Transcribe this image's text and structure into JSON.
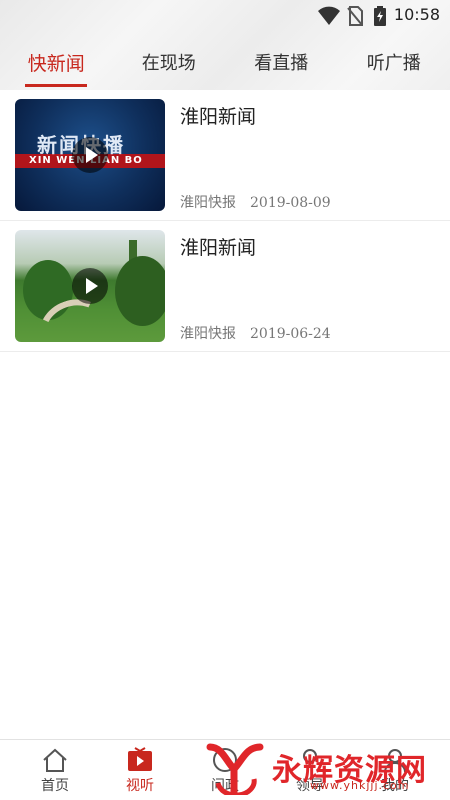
{
  "status_bar": {
    "time": "10:58"
  },
  "tabs": [
    {
      "label": "快新闻"
    },
    {
      "label": "在现场"
    },
    {
      "label": "看直播"
    },
    {
      "label": "听广播"
    }
  ],
  "news": [
    {
      "title": "淮阳新闻",
      "source": "淮阳快报",
      "date": "2019-08-09",
      "thumb_text_cn": "新闻快播",
      "thumb_text_en": "XIN WEN LIAN BO"
    },
    {
      "title": "淮阳新闻",
      "source": "淮阳快报",
      "date": "2019-06-24"
    }
  ],
  "bottom_nav": [
    {
      "label": "首页",
      "icon": "home-icon"
    },
    {
      "label": "视听",
      "icon": "video-tv-icon"
    },
    {
      "label": "问政",
      "icon": "question-icon"
    },
    {
      "label": "领导",
      "icon": "leader-icon"
    },
    {
      "label": "我的",
      "icon": "user-icon"
    }
  ],
  "watermark": {
    "text": "永辉资源网",
    "url": "www.yhkjjj.com"
  },
  "colors": {
    "accent": "#c8281e",
    "watermark": "#e0262a"
  }
}
